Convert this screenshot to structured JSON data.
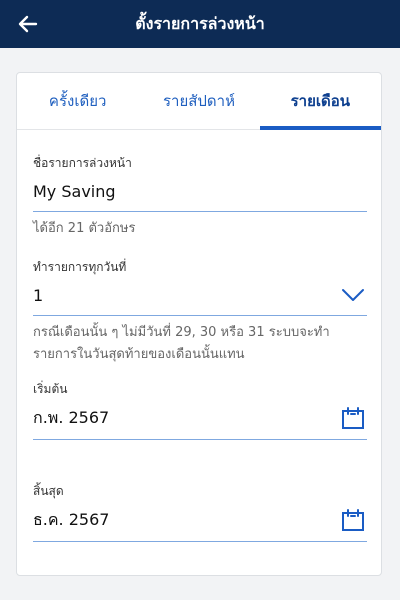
{
  "header": {
    "title": "ตั้งรายการล่วงหน้า"
  },
  "tabs": [
    {
      "label": "ครั้งเดียว"
    },
    {
      "label": "รายสัปดาห์"
    },
    {
      "label": "รายเดือน"
    }
  ],
  "form": {
    "name_label": "ชื่อรายการล่วงหน้า",
    "name_value": "My Saving",
    "name_hint": "ได้อีก 21 ตัวอักษร",
    "day_label": "ทำรายการทุกวันที่",
    "day_value": "1",
    "day_hint_1": "กรณีเดือนนั้น ๆ ไม่มีวันที่ 29, 30 หรือ 31 ระบบจะทำ",
    "day_hint_2": "รายการในวันสุดท้ายของเดือนนั้นแทน",
    "start_label": "เริ่มต้น",
    "start_value": "ก.พ. 2567",
    "end_label": "สิ้นสุด",
    "end_value": "ธ.ค. 2567"
  },
  "colors": {
    "header_bg": "#0d2b55",
    "accent": "#1a5cc4"
  }
}
